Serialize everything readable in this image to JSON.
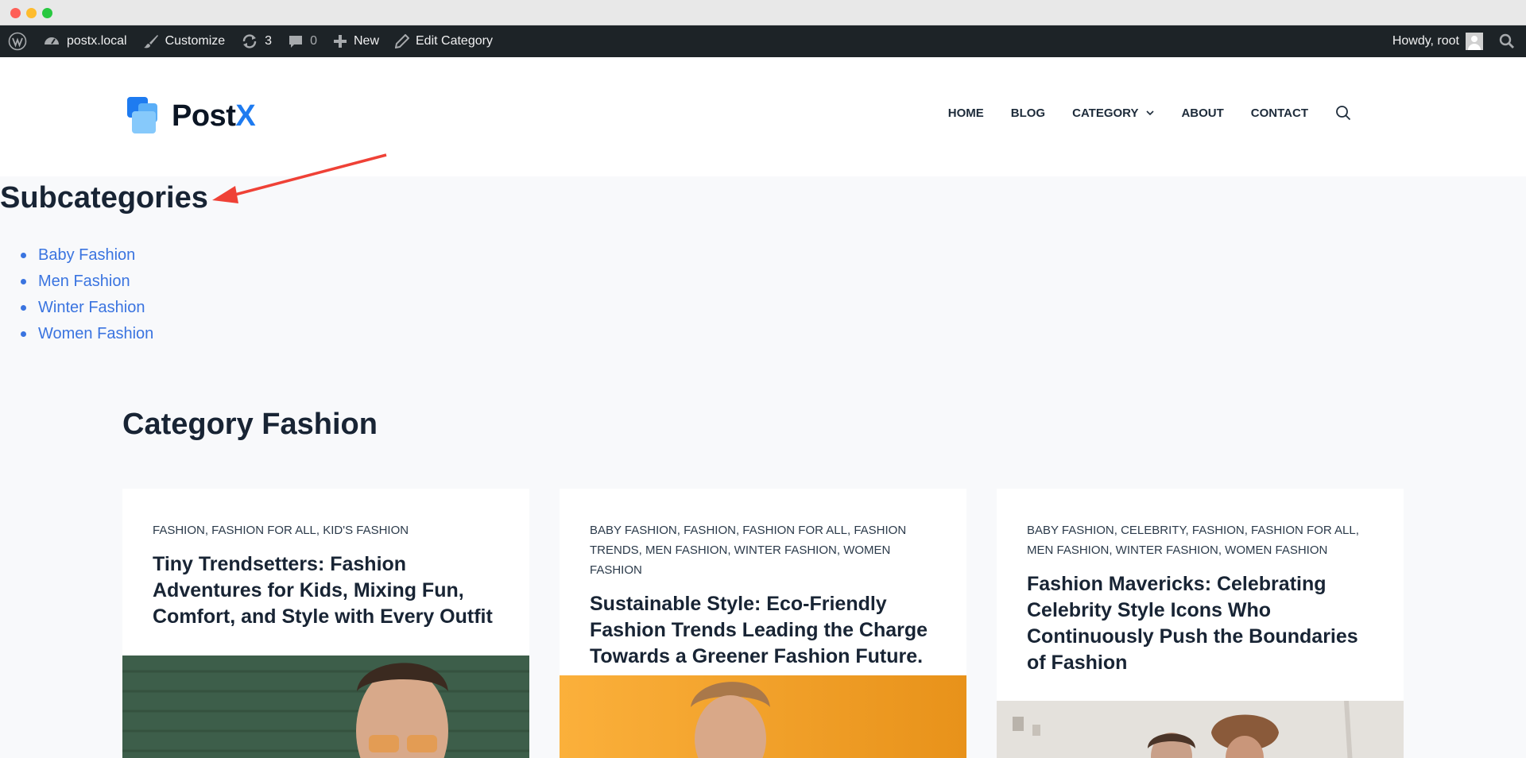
{
  "adminbar": {
    "site": "postx.local",
    "customize": "Customize",
    "updates": "3",
    "comments": "0",
    "new": "New",
    "edit": "Edit Category",
    "howdy": "Howdy, root"
  },
  "header": {
    "logo_text": "Post",
    "logo_x": "X",
    "nav": [
      "HOME",
      "BLOG",
      "CATEGORY",
      "ABOUT",
      "CONTACT"
    ]
  },
  "subcategories": {
    "title": "Subcategories",
    "items": [
      "Baby Fashion",
      "Men Fashion",
      "Winter Fashion",
      "Women Fashion"
    ]
  },
  "category": {
    "title": "Category Fashion"
  },
  "posts": [
    {
      "categories": "FASHION, FASHION FOR ALL, KID'S FASHION",
      "title": "Tiny Trendsetters: Fashion Adventures for Kids, Mixing Fun, Comfort, and Style with Every Outfit"
    },
    {
      "categories": "BABY FASHION, FASHION, FASHION FOR ALL, FASHION TRENDS, MEN FASHION, WINTER FASHION, WOMEN FASHION",
      "title": "Sustainable Style: Eco-Friendly Fashion Trends Leading the Charge Towards a Greener Fashion Future."
    },
    {
      "categories": "BABY FASHION, CELEBRITY, FASHION, FASHION FOR ALL, MEN FASHION, WINTER FASHION, WOMEN FASHION",
      "title": "Fashion Mavericks: Celebrating Celebrity Style Icons Who Continuously Push the Boundaries of Fashion"
    }
  ],
  "colors": {
    "link": "#3a74e0",
    "annotation_arrow": "#ef4136",
    "adminbar_bg": "#1d2327",
    "brand_blue": "#1e7bf0"
  }
}
